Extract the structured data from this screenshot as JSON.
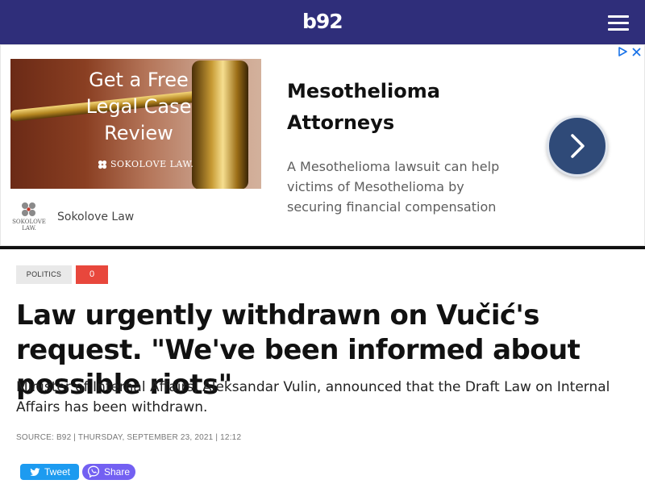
{
  "header": {
    "logo": "b92",
    "background": "#2f2e7a"
  },
  "ad": {
    "image_text": [
      "Get a Free",
      "Legal Case",
      "Review"
    ],
    "image_brand": "SOKOLOVE LAW.",
    "headline": "Mesothelioma Attorneys",
    "body": "A Mesothelioma lawsuit can help victims of Mesothelioma by securing financial compensation",
    "advertiser": "Sokolove Law",
    "advertiser_logo_text": "SOKOLOVE LAW.",
    "icons": [
      "adchoices-icon",
      "close-icon",
      "chevron-right-icon"
    ]
  },
  "article": {
    "category": "Politics",
    "comments_count": "0",
    "title": "Law urgently withdrawn on Vučić's request. \"We've been informed about possible riots\"",
    "lead": "Minister of Internal Affairs, Aleksandar Vulin, announced that the Draft Law on Internal Affairs has been withdrawn.",
    "meta": "Source: B92 | Thursday, September 23, 2021 | 12:12"
  },
  "share": {
    "tweet_label": "Tweet",
    "share_label": "Share"
  },
  "colors": {
    "accent": "#e8473c",
    "twitter": "#1d9bf0",
    "viber": "#7360f2"
  }
}
